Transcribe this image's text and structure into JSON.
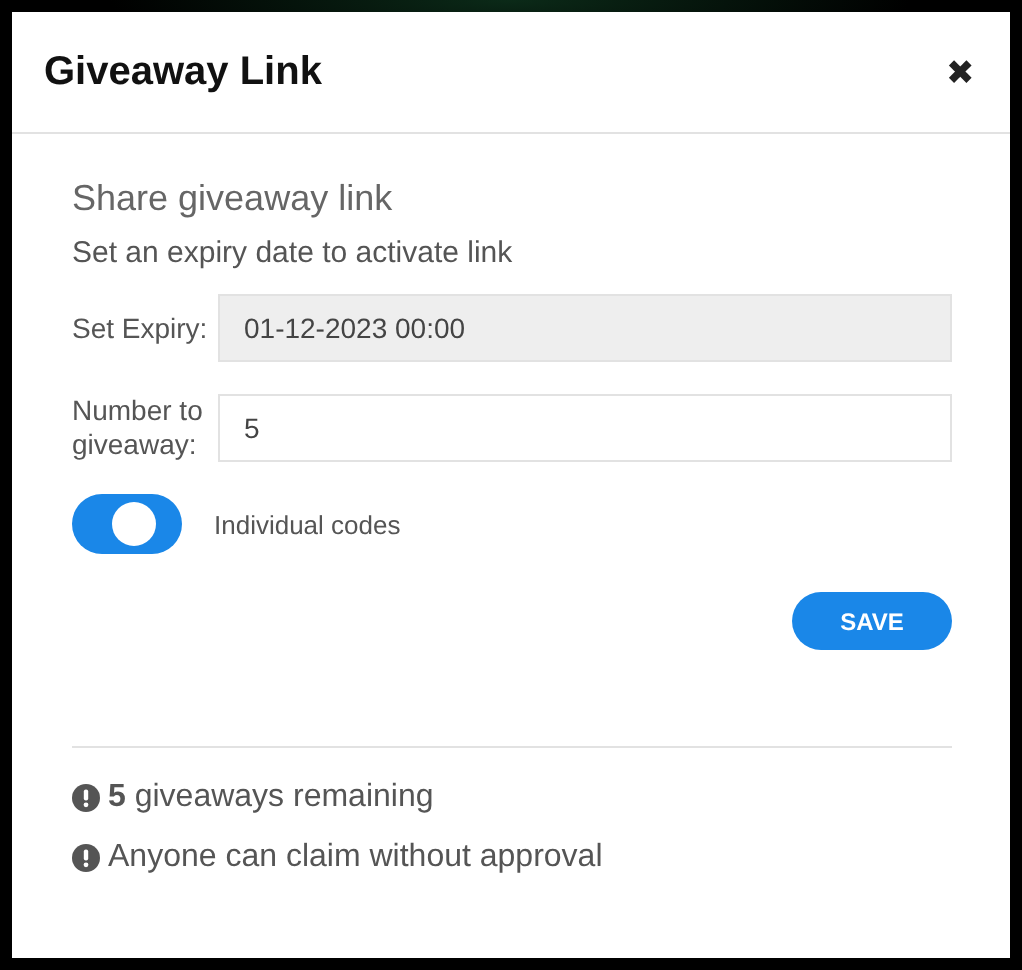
{
  "dialog": {
    "title": "Giveaway Link",
    "close": "✖"
  },
  "heading": "Share giveaway link",
  "subheading": "Set an expiry date to activate link",
  "fields": [
    {
      "label": "Set Expiry:",
      "value": "01-12-2023 00:00",
      "disabled": true
    },
    {
      "label": "Number to giveaway:",
      "value": "5",
      "disabled": false
    }
  ],
  "toggle": {
    "label": "Individual codes",
    "on": true
  },
  "save_button": "SAVE",
  "notes": [
    "**5** giveaways remaining",
    "Anyone can claim without approval"
  ]
}
